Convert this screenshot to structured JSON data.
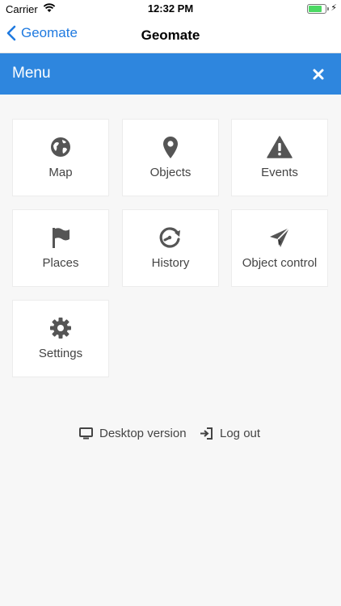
{
  "status": {
    "carrier": "Carrier",
    "time": "12:32 PM",
    "battery_level": 0.8
  },
  "nav": {
    "back_label": "Geomate",
    "title": "Geomate"
  },
  "menu": {
    "title": "Menu"
  },
  "tiles": [
    {
      "label": "Map",
      "icon": "globe-icon"
    },
    {
      "label": "Objects",
      "icon": "map-pin-icon"
    },
    {
      "label": "Events",
      "icon": "warning-icon"
    },
    {
      "label": "Places",
      "icon": "flag-icon"
    },
    {
      "label": "History",
      "icon": "history-icon"
    },
    {
      "label": "Object control",
      "icon": "paper-plane-icon"
    },
    {
      "label": "Settings",
      "icon": "gear-icon"
    }
  ],
  "footer": {
    "desktop_label": "Desktop version",
    "logout_label": "Log out"
  },
  "colors": {
    "accent": "#2e86de",
    "link": "#1f7ae0",
    "icon": "#555555"
  }
}
